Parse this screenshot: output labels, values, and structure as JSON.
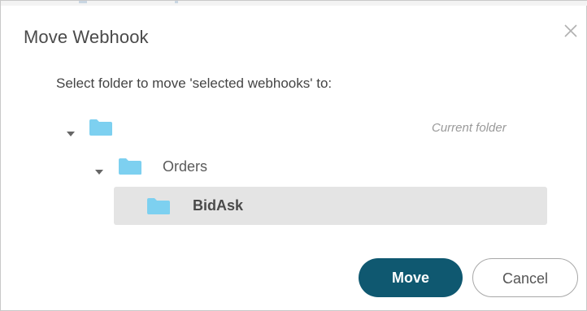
{
  "dialog": {
    "title": "Move Webhook",
    "prompt": "Select folder to move 'selected webhooks' to:",
    "close_icon": "close-icon"
  },
  "tree": {
    "root": {
      "label": "",
      "badge": "Current folder",
      "expanded": true
    },
    "orders": {
      "label": "Orders",
      "expanded": true
    },
    "bidask": {
      "label": "BidAsk",
      "selected": true
    }
  },
  "buttons": {
    "move_label": "Move",
    "cancel_label": "Cancel"
  },
  "colors": {
    "primary": "#0f5870",
    "folder": "#7dd0f0",
    "selection": "#e4e4e4"
  }
}
